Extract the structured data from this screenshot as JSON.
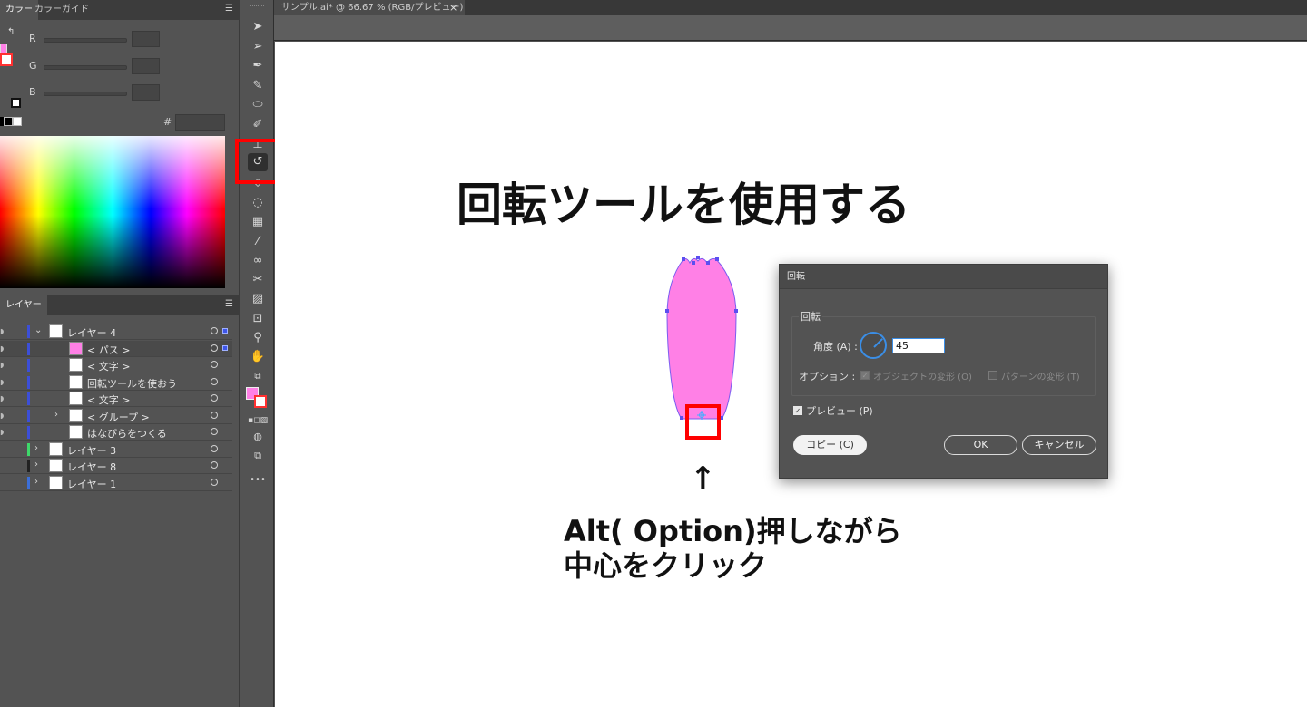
{
  "color_panel": {
    "tabs": [
      "カラー",
      "カラーガイド"
    ],
    "channels": [
      "R",
      "G",
      "B"
    ],
    "hex_label": "#"
  },
  "layers_panel": {
    "tab": "レイヤー",
    "rows": [
      {
        "name": "レイヤー 4",
        "chevron": "⌄",
        "bar_color": "#3c4fd8"
      },
      {
        "name": "< パス >",
        "chevron": "",
        "bar_color": "#3c4fd8"
      },
      {
        "name": "< 文字 >",
        "chevron": "",
        "bar_color": "#3c4fd8"
      },
      {
        "name": "回転ツールを使おう",
        "chevron": "",
        "bar_color": "#3c4fd8"
      },
      {
        "name": "< 文字 >",
        "chevron": "",
        "bar_color": "#3c4fd8"
      },
      {
        "name": "< グループ >",
        "chevron": "›",
        "bar_color": "#3c4fd8"
      },
      {
        "name": "はなびらをつくる",
        "chevron": "",
        "bar_color": "#3c4fd8"
      },
      {
        "name": "レイヤー 3",
        "chevron": "›",
        "bar_color": "#3ed86a"
      },
      {
        "name": "レイヤー 8",
        "chevron": "›",
        "bar_color": "#222222"
      },
      {
        "name": "レイヤー 1",
        "chevron": "›",
        "bar_color": "#3c6fd8"
      }
    ]
  },
  "toolbar": {
    "tools": [
      "selection-tool",
      "direct-selection-tool",
      "pen-tool",
      "curvature-tool",
      "ellipse-tool",
      "pencil-tool",
      "eraser-tool",
      "rotate-tool",
      "width-tool",
      "shape-builder-tool",
      "gradient-tool",
      "eyedropper-tool",
      "blend-tool",
      "symbol-sprayer-tool",
      "graph-tool",
      "artboard-tool",
      "zoom-tool",
      "hand-tool"
    ],
    "more": "•••"
  },
  "document": {
    "tab_title": "サンプル.ai* @ 66.67 % (RGB/プレビュー)",
    "tab_close": "×",
    "heading": "回転ツールを使用する",
    "arrow": "↑",
    "instruction_line1": "Alt( Option)押しながら",
    "instruction_line2": "中心をクリック",
    "petal_color": "#ff80e6"
  },
  "rotate_dialog": {
    "title": "回転",
    "group_label": "回転",
    "angle_label": "角度 (A) :",
    "angle_value": "45",
    "options_label": "オプション :",
    "opt_object": "オブジェクトの変形 (O)",
    "opt_pattern": "パターンの変形 (T)",
    "preview_label": "プレビュー (P)",
    "copy_button": "コピー (C)",
    "ok_button": "OK",
    "cancel_button": "キャンセル"
  },
  "colors": {
    "highlight": "#ff0000",
    "fill_swatch": "#ff80e6",
    "dialog_accent": "#3b8ee6"
  }
}
